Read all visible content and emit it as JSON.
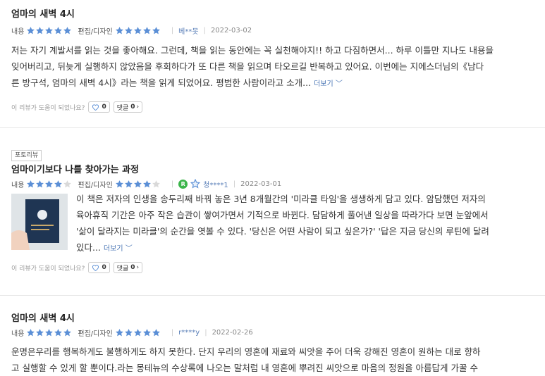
{
  "reviews": [
    {
      "title": "엄마의 새벽 4시",
      "content_label": "내용",
      "content_rating": 5,
      "design_label": "편집/디자인",
      "design_rating": 5,
      "author": "베**못",
      "date": "2022-03-02",
      "body_lines": [
        "저는 자기 계발서를 읽는 것을 좋아해요. 그런데, 책을 읽는 동안에는 꼭 실천해야지!! 하고 다짐하면서... 하루 이틀만 지나도 내용을",
        "잊어버리고, 뒤늦게 실행하지 않았음을 후회하다가 또 다른 책을 읽으며 타오르길 반복하고 있어요. 이번에는 지에스더님의《남다",
        "른 방구석, 엄마의 새벽 4시》라는 책을 읽게 되었어요. 평범한 사람이라고 소개..."
      ],
      "more": "더보기",
      "helpful_question": "이 리뷰가 도움이 되었나요?",
      "like_count": "0",
      "comment_label": "댓글",
      "comment_count": "0"
    },
    {
      "badge": "포토리뷰",
      "title": "엄마이기보다 나를 찾아가는 과정",
      "content_label": "내용",
      "content_rating": 4,
      "design_label": "편집/디자인",
      "design_rating": 4,
      "grade_letter": "R",
      "author": "청****1",
      "date": "2022-03-01",
      "body_lines": [
        "이 책은 저자의 인생을 송두리째 바꿔 놓은 3년 8개월간의 '미라클 타임'을 생생하게 담고 있다. 암담했던 저자의",
        "육아휴직 기간은 아주 작은 습관이 쌓여가면서 기적으로 바뀐다. 담담하게 풀어낸 일상을 따라가다 보면 눈앞에서",
        "'삶이 달라지는 미라클'의 순간을 엿볼 수 있다. '당신은 어떤 사람이 되고 싶은가?' '답은 지금 당신의 루틴에 달려",
        "있다..."
      ],
      "cover_text": "엄마의 새벽 4시",
      "more": "더보기",
      "helpful_question": "이 리뷰가 도움이 되었나요?",
      "like_count": "0",
      "comment_label": "댓글",
      "comment_count": "0"
    },
    {
      "title": "엄마의 새벽 4시",
      "content_label": "내용",
      "content_rating": 5,
      "design_label": "편집/디자인",
      "design_rating": 5,
      "author": "r****y",
      "date": "2022-02-26",
      "body_lines": [
        "운명은우리를 행복하게도 불행하게도 하지 못한다. 단지 우리의 영혼에 재료와 씨앗을 주어 더욱 강해진 영혼이 원하는 대로 향하",
        "고 실행할 수 있게 할 뿐이다.라는 몽테뉴의 수상록에 나오는 말처럼 내 영혼에 뿌려진 씨앗으로 마음의 정원을 아름답게 가꿀 수"
      ]
    }
  ],
  "colors": {
    "star_on": "#5b8fd6",
    "star_off": "#d9d9d9",
    "link": "#4a76b5"
  }
}
